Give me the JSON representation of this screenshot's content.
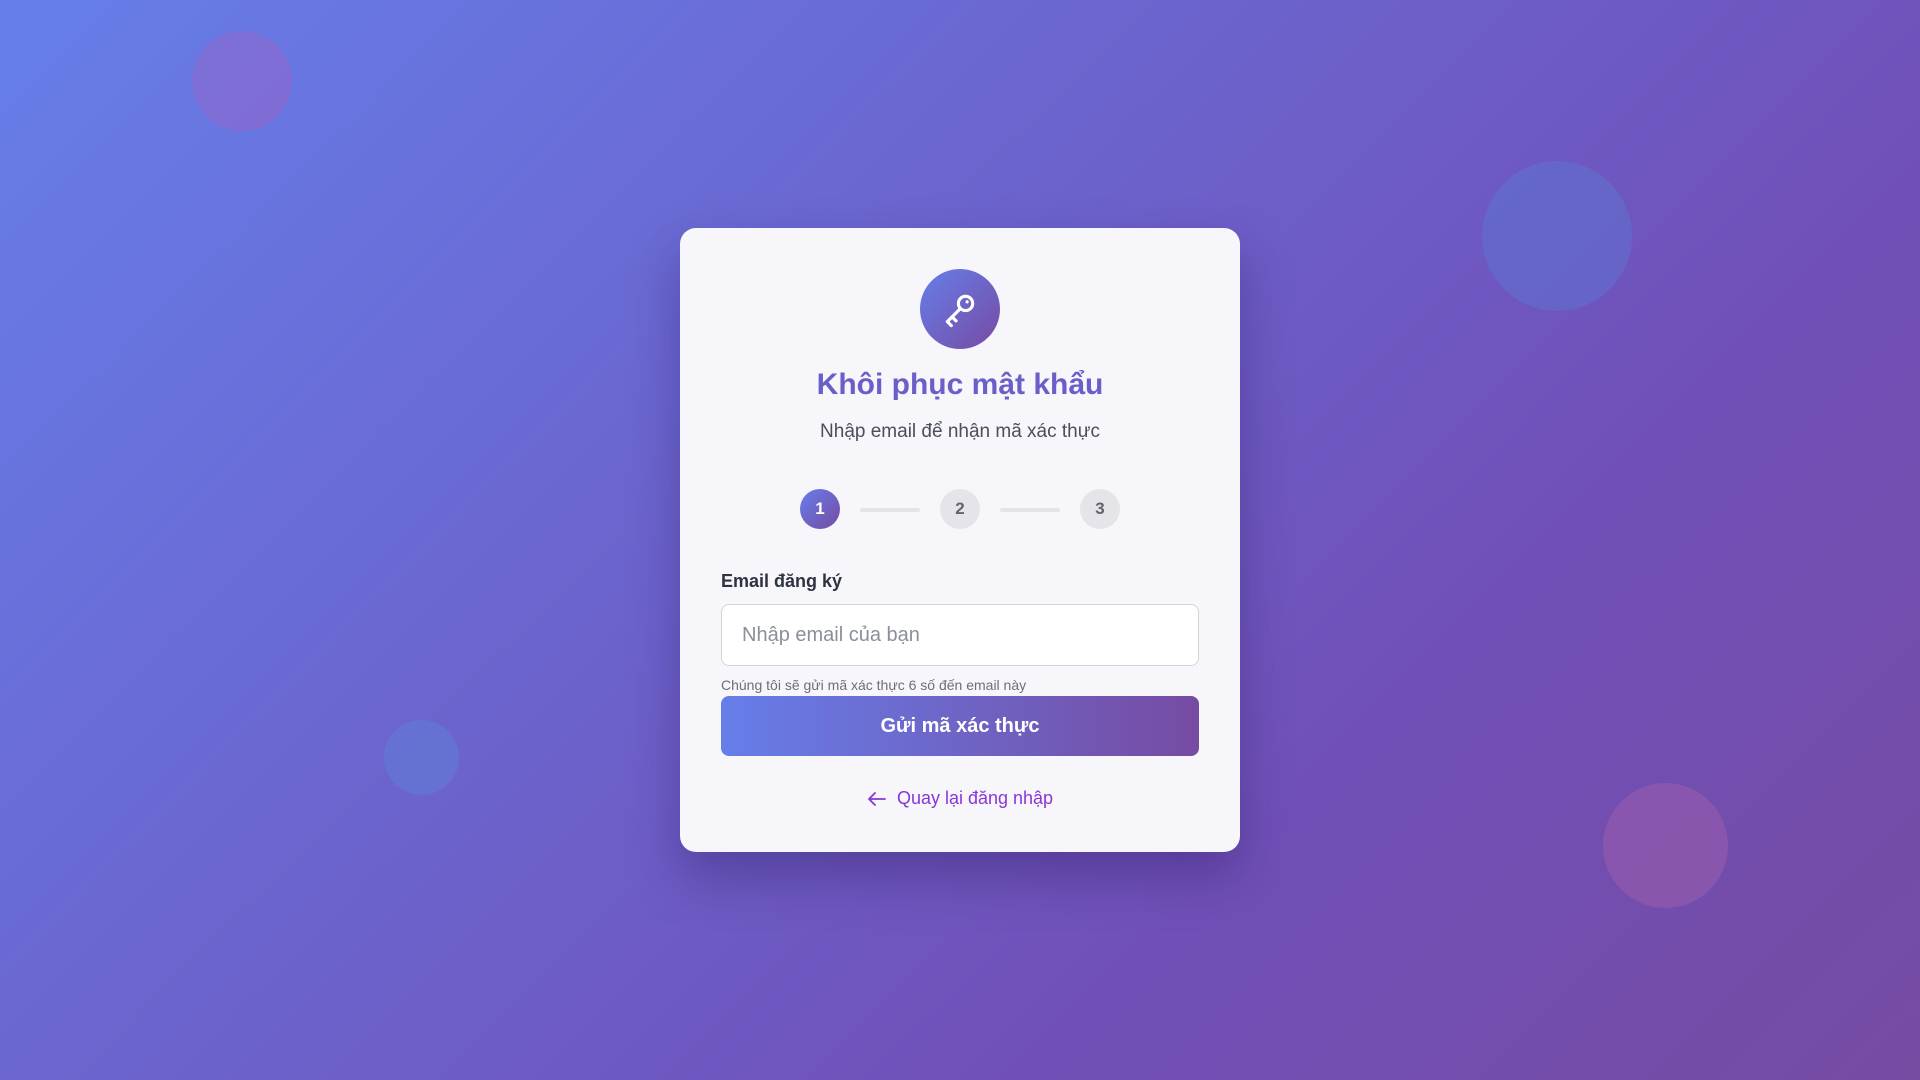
{
  "brand": {
    "icon": "key-icon",
    "gradient_start": "#667eea",
    "gradient_end": "#764ba2"
  },
  "header": {
    "title": "Khôi phục mật khẩu",
    "subtitle": "Nhập email để nhận mã xác thực"
  },
  "steps": [
    {
      "label": "1",
      "state": "active"
    },
    {
      "label": "2",
      "state": "inactive"
    },
    {
      "label": "3",
      "state": "inactive"
    }
  ],
  "form": {
    "email_label": "Email đăng ký",
    "email_placeholder": "Nhập email của bạn",
    "email_value": "",
    "hint": "Chúng tôi sẽ gửi mã xác thực 6 số đến email này",
    "submit_label": "Gửi mã xác thực"
  },
  "back_link": {
    "icon": "arrow-left-icon",
    "label": "Quay lại đăng nhập",
    "color": "#8a35d6"
  }
}
